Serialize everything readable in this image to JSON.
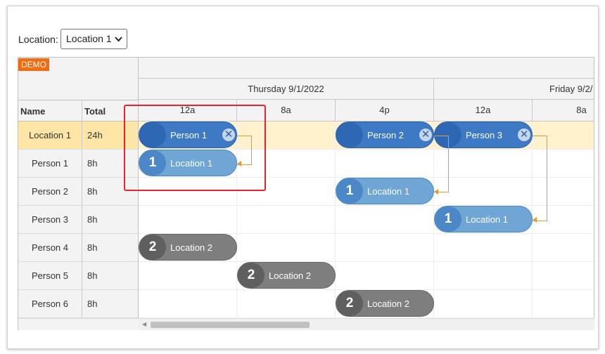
{
  "filter": {
    "label": "Location:",
    "selected": "Location 1"
  },
  "badge": "DEMO",
  "row_headers": {
    "name": "Name",
    "total": "Total"
  },
  "days": [
    "Thursday 9/1/2022",
    "Friday 9/2/"
  ],
  "hours": [
    "12a",
    "8a",
    "4p",
    "12a",
    "8a"
  ],
  "rows": [
    {
      "name": "Location 1",
      "total": "24h"
    },
    {
      "name": "Person 1",
      "total": "8h"
    },
    {
      "name": "Person 2",
      "total": "8h"
    },
    {
      "name": "Person 3",
      "total": "8h"
    },
    {
      "name": "Person 4",
      "total": "8h"
    },
    {
      "name": "Person 5",
      "total": "8h"
    },
    {
      "name": "Person 6",
      "total": "8h"
    }
  ],
  "events": {
    "person1": "Person 1",
    "person2": "Person 2",
    "person3": "Person 3",
    "p1_loc": {
      "num": "1",
      "text": "Location 1"
    },
    "p2_loc": {
      "num": "1",
      "text": "Location 1"
    },
    "p3_loc": {
      "num": "1",
      "text": "Location 1"
    },
    "p4_loc": {
      "num": "2",
      "text": "Location 2"
    },
    "p5_loc": {
      "num": "2",
      "text": "Location 2"
    },
    "p6_loc": {
      "num": "2",
      "text": "Location 2"
    },
    "delete_glyph": "✕"
  },
  "colors": {
    "accent": "#3d79c4",
    "location_assigned": "#6fa6d6",
    "location_other": "#7e7e7e",
    "parent_row": "#ffe6a6",
    "link": "#e09a3e",
    "highlight": "#e8232f",
    "demo_badge": "#f26b0f"
  }
}
